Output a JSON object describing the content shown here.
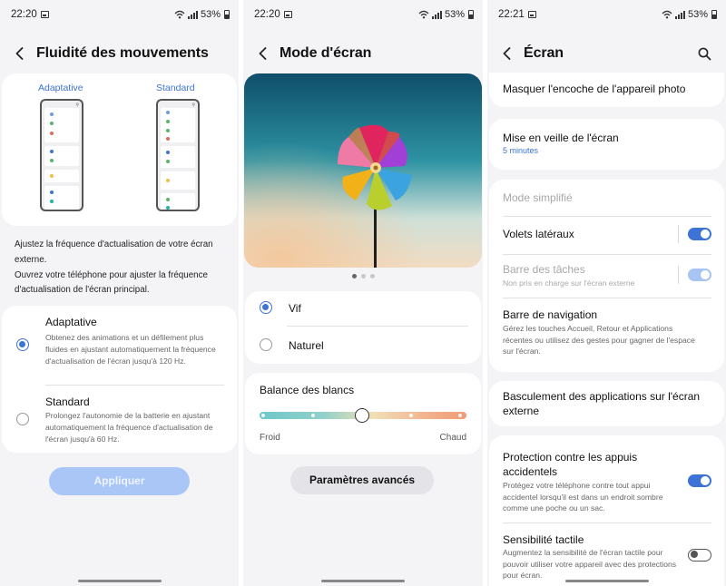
{
  "screen1": {
    "status": {
      "time": "22:20",
      "battery": "53%"
    },
    "title": "Fluidité des mouvements",
    "preview": {
      "left_label": "Adaptative",
      "right_label": "Standard"
    },
    "description": [
      "Ajustez la fréquence d'actualisation de votre écran externe.",
      "Ouvrez votre téléphone pour ajuster la fréquence d'actualisation de l'écran principal."
    ],
    "options": [
      {
        "title": "Adaptative",
        "desc": "Obtenez des animations et un défilement plus fluides en ajustant automatiquement la fréquence d'actualisation de l'écran jusqu'à 120 Hz.",
        "selected": true
      },
      {
        "title": "Standard",
        "desc": "Prolongez l'autonomie de la batterie en ajustant automatiquement la fréquence d'actualisation de l'écran jusqu'à 60 Hz.",
        "selected": false
      }
    ],
    "apply_label": "Appliquer"
  },
  "screen2": {
    "status": {
      "time": "22:20",
      "battery": "53%"
    },
    "title": "Mode d'écran",
    "carousel": {
      "pages": 3,
      "active": 1
    },
    "modes": [
      {
        "label": "Vif",
        "selected": true
      },
      {
        "label": "Naturel",
        "selected": false
      }
    ],
    "white_balance": {
      "title": "Balance des blancs",
      "min_label": "Froid",
      "max_label": "Chaud",
      "steps": 5,
      "value": 2
    },
    "advanced_label": "Paramètres avancés"
  },
  "screen3": {
    "status": {
      "time": "22:21",
      "battery": "53%"
    },
    "title": "Écran",
    "items": {
      "notch": "Masquer l'encoche de l'appareil photo",
      "sleep": {
        "title": "Mise en veille de l'écran",
        "value": "5 minutes"
      },
      "simple": "Mode simplifié",
      "edge": {
        "title": "Volets latéraux",
        "on": true
      },
      "taskbar": {
        "title": "Barre des tâches",
        "desc": "Non pris en charge sur l'écran externe",
        "on": true
      },
      "navbar": {
        "title": "Barre de navigation",
        "desc": "Gérez les touches Accueil, Retour et Applications récentes ou utilisez des gestes pour gagner de l'espace sur l'écran."
      },
      "switch_apps": "Basculement des applications sur l'écran externe",
      "protection": {
        "title": "Protection contre les appuis accidentels",
        "desc": "Protégez votre téléphone contre tout appui accidentel lorsqu'il est dans un endroit sombre comme une poche ou un sac.",
        "on": true
      },
      "touch": {
        "title": "Sensibilité tactile",
        "desc": "Augmentez la sensibilité de l'écran tactile pour pouvoir utiliser votre appareil avec des protections pour écran.",
        "on": false
      }
    }
  },
  "colors": {
    "accent": "#3e73d6",
    "apply_disabled": "#a9c6f7",
    "background": "#f4f4f6"
  }
}
